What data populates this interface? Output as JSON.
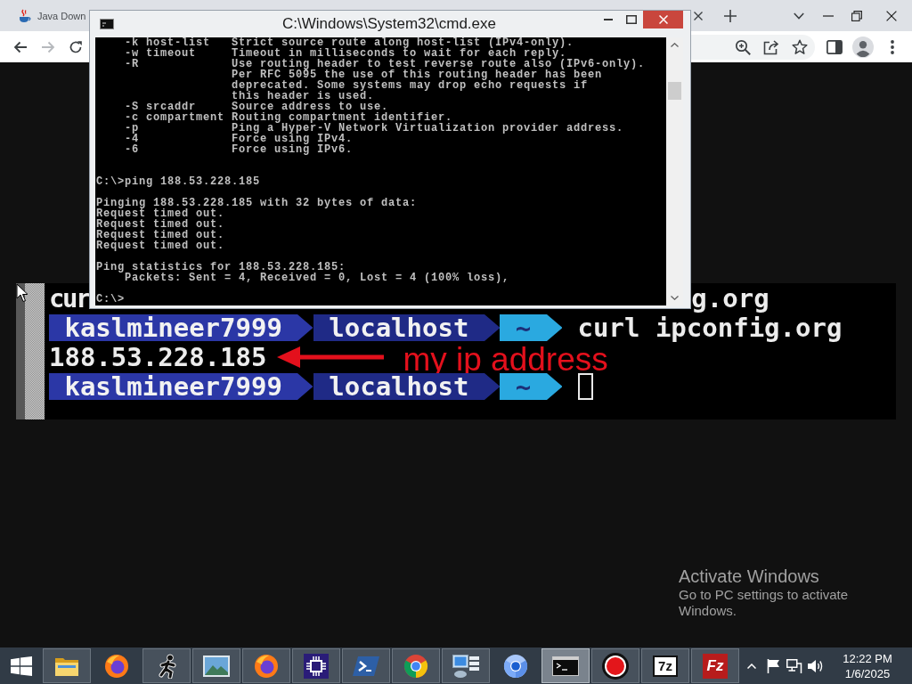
{
  "browser": {
    "tabs": [
      {
        "title": "Java Down",
        "selected": false
      }
    ],
    "nav_buttons": [
      {
        "kind": "back",
        "disabled": false
      },
      {
        "kind": "forward",
        "disabled": true
      },
      {
        "kind": "reload",
        "disabled": false
      }
    ]
  },
  "cmd_window": {
    "title": "C:\\Windows\\System32\\cmd.exe",
    "output": "    -k host-list   Strict source route along host-list (IPv4-only).\n    -w timeout     Timeout in milliseconds to wait for each reply.\n    -R             Use routing header to test reverse route also (IPv6-only).\n                   Per RFC 5095 the use of this routing header has been\n                   deprecated. Some systems may drop echo requests if\n                   this header is used.\n    -S srcaddr     Source address to use.\n    -c compartment Routing compartment identifier.\n    -p             Ping a Hyper-V Network Virtualization provider address.\n    -4             Force using IPv4.\n    -6             Force using IPv6.\n\n\nC:\\>ping 188.53.228.185\n\nPinging 188.53.228.185 with 32 bytes of data:\nRequest timed out.\nRequest timed out.\nRequest timed out.\nRequest timed out.\n\nPing statistics for 188.53.228.185:\n    Packets: Sent = 4, Received = 0, Lost = 4 (100% loss),\n\nC:\\>"
  },
  "page": {
    "terminal": {
      "lines": [
        {
          "kind": "covered",
          "parts": [
            "cur",
            "g.org"
          ]
        },
        {
          "kind": "prompt",
          "user": "kaslmineer7999",
          "host": "localhost",
          "path": "~",
          "command": "curl ipconfig.org",
          "cursor": false
        },
        {
          "kind": "output",
          "text": "188.53.228.185",
          "annotation": "my ip address"
        },
        {
          "kind": "prompt",
          "user": "kaslmineer7999",
          "host": "localhost",
          "path": "~",
          "cursor": true
        }
      ]
    }
  },
  "activation_notice": {
    "title": "Activate Windows",
    "message": "Go to PC settings to activate Windows."
  },
  "taskbar": {
    "items": [
      {
        "kind": "folder",
        "running": true,
        "selected": false
      },
      {
        "kind": "flame-globe",
        "running": false,
        "selected": false
      },
      {
        "kind": "runner",
        "running": true,
        "selected": false
      },
      {
        "kind": "landscape",
        "running": true,
        "selected": false
      },
      {
        "kind": "flame-globe",
        "running": true,
        "selected": false
      },
      {
        "kind": "chip",
        "running": true,
        "selected": false
      },
      {
        "kind": "chevron-tile",
        "running": true,
        "selected": false
      },
      {
        "kind": "segmented-ring",
        "running": true,
        "selected": false
      },
      {
        "kind": "monitor-panel",
        "running": true,
        "selected": false
      },
      {
        "kind": "orb",
        "running": false,
        "selected": false
      },
      {
        "kind": "console",
        "running": true,
        "selected": true
      },
      {
        "kind": "record",
        "running": true,
        "selected": false
      },
      {
        "kind": "light-tile",
        "label": "7z",
        "running": true,
        "selected": false
      },
      {
        "kind": "red-tile",
        "label": "Fz",
        "running": true,
        "selected": false
      }
    ],
    "clock": {
      "time": "12:22 PM",
      "date": "1/6/2025"
    }
  }
}
